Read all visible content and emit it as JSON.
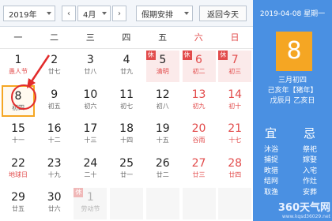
{
  "toolbar": {
    "year_select": "2019年",
    "prev_icon": "chevron-left",
    "next_icon": "chevron-right",
    "month_select": "4月",
    "holiday_select": "假期安排",
    "today_button": "返回今天"
  },
  "weekdays": [
    "一",
    "二",
    "三",
    "四",
    "五",
    "六",
    "日"
  ],
  "weeks": [
    [
      {
        "day": "1",
        "sub": "愚人节",
        "style": "fest"
      },
      {
        "day": "2",
        "sub": "廿七"
      },
      {
        "day": "3",
        "sub": "廿八"
      },
      {
        "day": "4",
        "sub": "廿九"
      },
      {
        "day": "5",
        "sub": "清明",
        "style": "holiday fest",
        "tag": "休"
      },
      {
        "day": "6",
        "sub": "初二",
        "style": "holiday red",
        "tag": "休"
      },
      {
        "day": "7",
        "sub": "初三",
        "style": "holiday red",
        "tag": "休"
      }
    ],
    [
      {
        "day": "8",
        "sub": "初四",
        "style": "selected"
      },
      {
        "day": "9",
        "sub": "初五"
      },
      {
        "day": "10",
        "sub": "初六"
      },
      {
        "day": "11",
        "sub": "初七"
      },
      {
        "day": "12",
        "sub": "初八"
      },
      {
        "day": "13",
        "sub": "初九",
        "style": "red"
      },
      {
        "day": "14",
        "sub": "初十",
        "style": "red"
      }
    ],
    [
      {
        "day": "15",
        "sub": "十一"
      },
      {
        "day": "16",
        "sub": "十二"
      },
      {
        "day": "17",
        "sub": "十三"
      },
      {
        "day": "18",
        "sub": "十四"
      },
      {
        "day": "19",
        "sub": "十五"
      },
      {
        "day": "20",
        "sub": "谷雨",
        "style": "red fest"
      },
      {
        "day": "21",
        "sub": "十七",
        "style": "red"
      }
    ],
    [
      {
        "day": "22",
        "sub": "地球日",
        "style": "fest"
      },
      {
        "day": "23",
        "sub": "十九"
      },
      {
        "day": "24",
        "sub": "二十"
      },
      {
        "day": "25",
        "sub": "廿一"
      },
      {
        "day": "26",
        "sub": "廿二"
      },
      {
        "day": "27",
        "sub": "廿三",
        "style": "red"
      },
      {
        "day": "28",
        "sub": "廿四",
        "style": "red"
      }
    ],
    [
      {
        "day": "29",
        "sub": "廿五"
      },
      {
        "day": "30",
        "sub": "廿六"
      },
      {
        "day": "1",
        "sub": "劳动节",
        "style": "off",
        "tag": "休",
        "tag_style": "off-tag"
      },
      {
        "day": "",
        "sub": "",
        "style": "off"
      },
      {
        "day": "",
        "sub": "",
        "style": "off"
      },
      {
        "day": "",
        "sub": "",
        "style": "off"
      },
      {
        "day": "",
        "sub": "",
        "style": "off"
      }
    ]
  ],
  "panel": {
    "date_line": "2019-04-08  星期一",
    "big_day": "8",
    "lunar_lines": [
      "三月初四",
      "己亥年【猪年】",
      "戊辰月 乙亥日"
    ],
    "yi_label": "宜",
    "ji_label": "忌",
    "yi_items": [
      "沐浴",
      "捕捉",
      "畋猎",
      "结网",
      "取渔"
    ],
    "ji_items": [
      "祭祀",
      "嫁娶",
      "入宅",
      "作灶",
      "安葬"
    ],
    "watermark_main": "360天气网",
    "watermark_sub": "www.kqsd36029.net"
  },
  "colors": {
    "accent_blue": "#4a90e2",
    "highlight_orange": "#f5a623",
    "weekend_red": "#e24b4b"
  }
}
